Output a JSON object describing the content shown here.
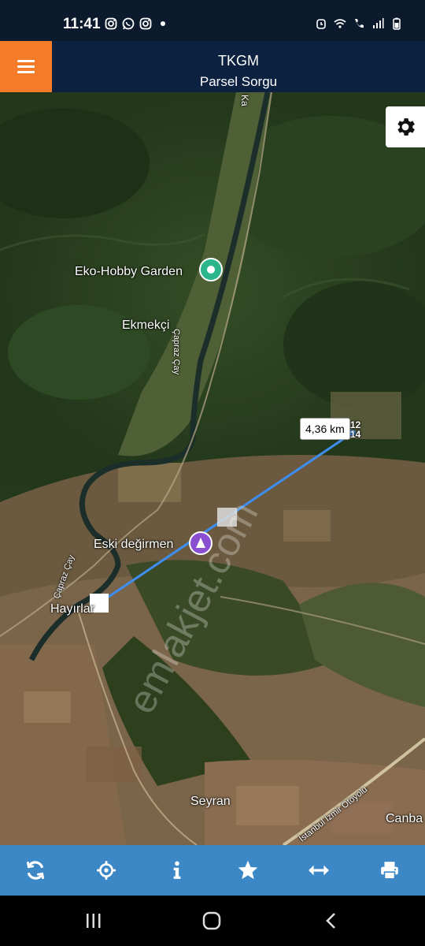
{
  "status": {
    "time": "11:41",
    "notifications": [
      "instagram-icon",
      "whatsapp-icon",
      "instagram-icon",
      "dot-icon"
    ],
    "system_icons": [
      "alarm-icon",
      "wifi-icon",
      "call-icon",
      "signal-icon",
      "battery-icon"
    ]
  },
  "header": {
    "title": "TKGM",
    "subtitle": "Parsel Sorgu",
    "menu_icon": "hamburger-icon",
    "accent": "#f47b2a",
    "background": "#0c2240"
  },
  "map": {
    "settings_icon": "gear-icon",
    "labels": {
      "eko_hobby": "Eko-Hobby Garden",
      "ekmekci": "Ekmekçi",
      "capraz_cay_north": "Çapraz Çay",
      "eski_degirmen": "Eski değirmen",
      "capraz_cay_south": "Çapraz Çay",
      "hayirlar": "Hayırlar",
      "seyran": "Seyran",
      "otoyolu": "İstanbul İzmir Otoyolu",
      "canba": "Canba",
      "ka": "Ka",
      "parcel": "12 14"
    },
    "distance": "4,36 km",
    "watermark": "emlakjet.com",
    "measure_color": "#3d8ef0"
  },
  "toolbar": {
    "items": [
      "refresh-icon",
      "locate-icon",
      "info-icon",
      "favorite-icon",
      "measure-icon",
      "print-icon"
    ],
    "color": "#3c87c5"
  },
  "nav": {
    "items": [
      "recent-apps-icon",
      "home-icon",
      "back-icon"
    ]
  }
}
